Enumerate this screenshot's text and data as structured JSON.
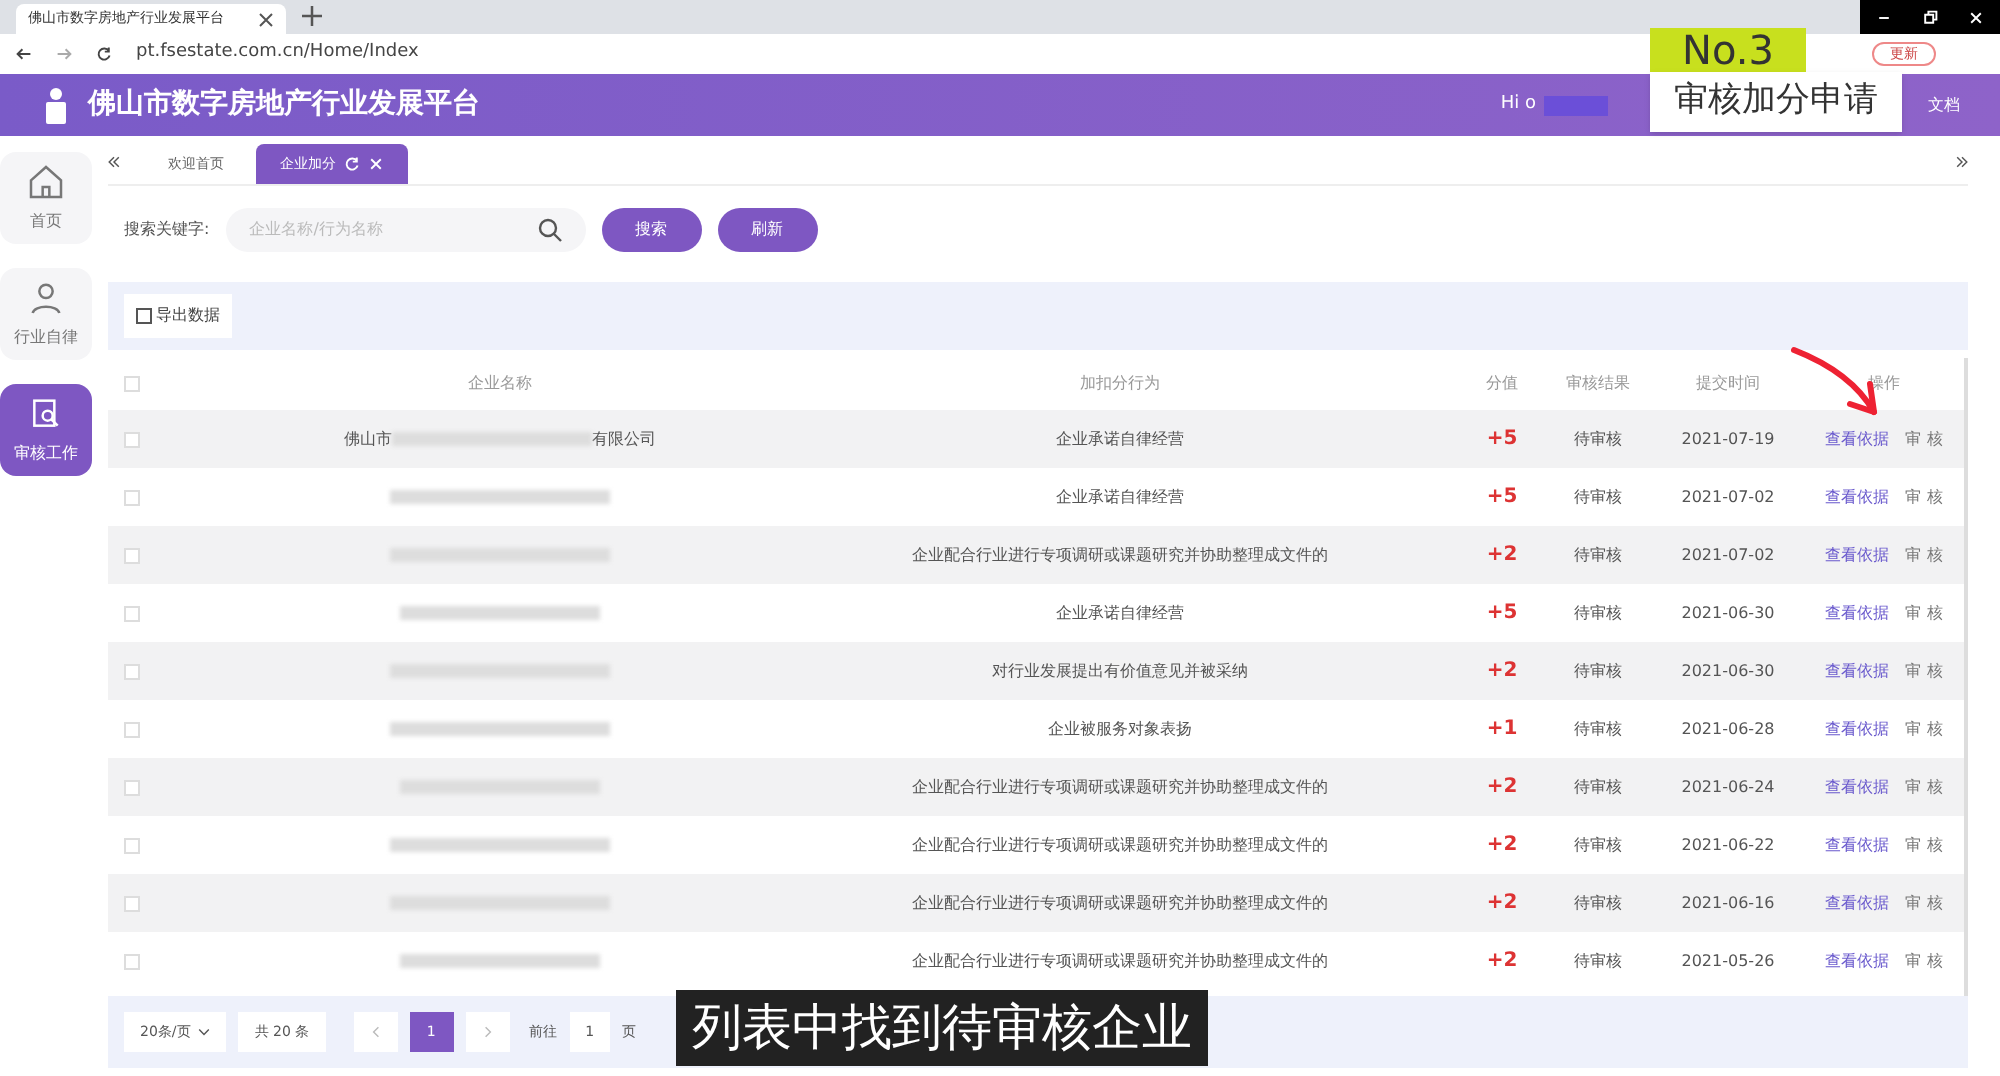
{
  "browser": {
    "tab_title": "佛山市数字房地产行业发展平台",
    "url": "pt.fsestate.com.cn/Home/Index",
    "update_button": "更新"
  },
  "header": {
    "title": "佛山市数字房地产行业发展平台",
    "greeting": "Hi o",
    "link": "文档"
  },
  "sidebar": {
    "items": [
      {
        "label": "首页",
        "selected": false
      },
      {
        "label": "行业自律",
        "selected": false
      },
      {
        "label": "审核工作",
        "selected": true
      }
    ]
  },
  "page_tabs": [
    {
      "label": "欢迎首页",
      "selected": false
    },
    {
      "label": "企业加分",
      "selected": true
    }
  ],
  "search": {
    "label": "搜索关键字:",
    "placeholder": "企业名称/行为名称",
    "buttons": [
      "搜索",
      "刷新"
    ]
  },
  "export_button": "导出数据",
  "table": {
    "header_checked": false,
    "columns": [
      "企业名称",
      "加扣分行为",
      "分值",
      "审核结果",
      "提交时间",
      "操作"
    ],
    "rows": [
      {
        "checked": false,
        "company_prefix": "佛山市",
        "company_suffix": "有限公司",
        "behavior": "企业承诺自律经营",
        "score": "+5",
        "result": "待审核",
        "time": "2021-07-19",
        "actions": [
          "查看依据",
          "审 核"
        ]
      },
      {
        "checked": false,
        "behavior": "企业承诺自律经营",
        "score": "+5",
        "result": "待审核",
        "time": "2021-07-02",
        "actions": [
          "查看依据",
          "审 核"
        ]
      },
      {
        "checked": false,
        "behavior": "企业配合行业进行专项调研或课题研究并协助整理成文件的",
        "score": "+2",
        "result": "待审核",
        "time": "2021-07-02",
        "actions": [
          "查看依据",
          "审 核"
        ]
      },
      {
        "checked": false,
        "behavior": "企业承诺自律经营",
        "score": "+5",
        "result": "待审核",
        "time": "2021-06-30",
        "actions": [
          "查看依据",
          "审 核"
        ]
      },
      {
        "checked": false,
        "behavior": "对行业发展提出有价值意见并被采纳",
        "score": "+2",
        "result": "待审核",
        "time": "2021-06-30",
        "actions": [
          "查看依据",
          "审 核"
        ]
      },
      {
        "checked": false,
        "behavior": "企业被服务对象表扬",
        "score": "+1",
        "result": "待审核",
        "time": "2021-06-28",
        "actions": [
          "查看依据",
          "审 核"
        ]
      },
      {
        "checked": false,
        "behavior": "企业配合行业进行专项调研或课题研究并协助整理成文件的",
        "score": "+2",
        "result": "待审核",
        "time": "2021-06-24",
        "actions": [
          "查看依据",
          "审 核"
        ]
      },
      {
        "checked": false,
        "behavior": "企业配合行业进行专项调研或课题研究并协助整理成文件的",
        "score": "+2",
        "result": "待审核",
        "time": "2021-06-22",
        "actions": [
          "查看依据",
          "审 核"
        ]
      },
      {
        "checked": false,
        "behavior": "企业配合行业进行专项调研或课题研究并协助整理成文件的",
        "score": "+2",
        "result": "待审核",
        "time": "2021-06-16",
        "actions": [
          "查看依据",
          "审 核"
        ]
      },
      {
        "checked": false,
        "behavior": "企业配合行业进行专项调研或课题研究并协助整理成文件的",
        "score": "+2",
        "result": "待审核",
        "time": "2021-05-26",
        "actions": [
          "查看依据",
          "审 核"
        ]
      }
    ]
  },
  "pagination": {
    "page_size": "20条/页",
    "total": "共 20 条",
    "pages": [
      {
        "label": "1",
        "selected": true
      }
    ],
    "goto_label": "前往",
    "goto_value": "1",
    "goto_unit": "页"
  },
  "overlay": {
    "badge": "No.3",
    "caption": "审核加分申请",
    "subtitle": "列表中找到待审核企业"
  }
}
